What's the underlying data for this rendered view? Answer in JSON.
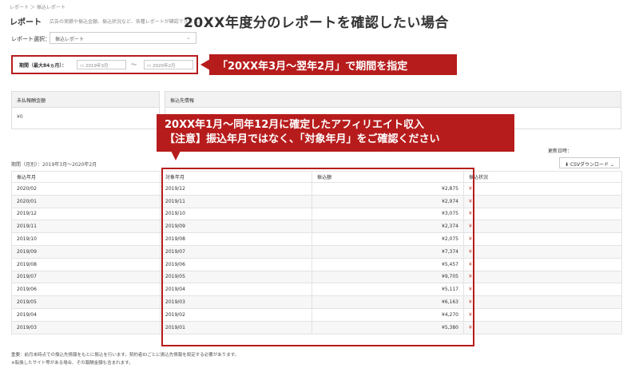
{
  "breadcrumb": "レポート ＞ 振込レポート",
  "page": {
    "title": "レポート",
    "description": "広告の実績や振込金額、振込状況など、各種レポートが確認できます。",
    "headline": "20XX年度分のレポートを確認したい場合"
  },
  "report_select": {
    "label": "レポート選択：",
    "value": "振込レポート"
  },
  "period": {
    "label": "期間（最大84ヵ月）：",
    "from": "2019年3月",
    "separator": "〜",
    "to": "2020年2月"
  },
  "callouts": {
    "period": "「20XX年3月〜翌年2月」で期間を指定",
    "line1": "20XX年1月〜同年12月に確定したアフィリエイト収入",
    "line2": "【注意】振込年月ではなく、「対象年月」をご確認ください"
  },
  "unpaid": {
    "header": "未払報酬金額",
    "value": "¥0"
  },
  "bank": {
    "header": "振込先情報"
  },
  "update_label": "更新日時：",
  "csv_button": "CSVダウンロード",
  "table_caption": "期間（月別）：2019年3月〜2020年2月",
  "table": {
    "headers": [
      "振込年月",
      "対象年月",
      "振込額",
      "振込状況"
    ],
    "rows": [
      [
        "2020/02",
        "2019/12",
        "¥2,875",
        "¥"
      ],
      [
        "2020/01",
        "2019/11",
        "¥2,974",
        "¥"
      ],
      [
        "2019/12",
        "2019/10",
        "¥3,075",
        "¥"
      ],
      [
        "2019/11",
        "2019/09",
        "¥2,374",
        "¥"
      ],
      [
        "2019/10",
        "2019/08",
        "¥2,075",
        "¥"
      ],
      [
        "2019/09",
        "2019/07",
        "¥7,374",
        "¥"
      ],
      [
        "2019/08",
        "2019/06",
        "¥5,457",
        "¥"
      ],
      [
        "2019/07",
        "2019/05",
        "¥9,705",
        "¥"
      ],
      [
        "2019/06",
        "2019/04",
        "¥5,117",
        "¥"
      ],
      [
        "2019/05",
        "2019/03",
        "¥6,163",
        "¥"
      ],
      [
        "2019/04",
        "2019/02",
        "¥4,270",
        "¥"
      ],
      [
        "2019/03",
        "2019/01",
        "¥5,380",
        "¥"
      ]
    ]
  },
  "footnotes": {
    "note1": "重要：前月末時点での振込先情報をもとに振込を行います。契約者IDごとに振込先情報を設定する必要があります。",
    "note2": "※転換したサイト等がある場合、その報酬金額も含まれます。"
  },
  "colors": {
    "accent": "#b71c1c",
    "highlight": "#b71c1c"
  }
}
